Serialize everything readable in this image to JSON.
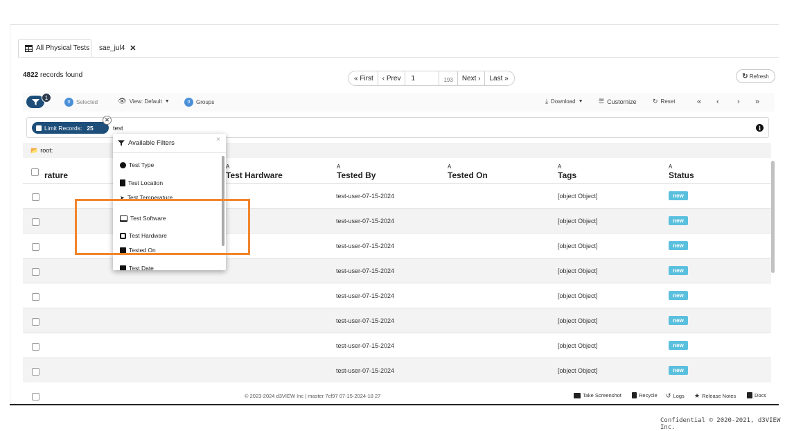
{
  "tabs": [
    {
      "label": "All Physical Tests",
      "active": true
    },
    {
      "label": "sae_jul4",
      "active": false
    }
  ],
  "records": {
    "count": "4822",
    "suffix": "records found"
  },
  "pager": {
    "first": "« First",
    "prev": "‹ Prev",
    "page": "1",
    "total": "193",
    "next": "Next ›",
    "last": "Last »"
  },
  "refresh_label": "Refresh",
  "toolbar": {
    "filter_count": "1",
    "selected_count": "0",
    "selected_label": "Selected",
    "view_label": "View: Default",
    "groups_count": "0",
    "groups_label": "Groups",
    "download_label": "Download",
    "customize_label": "Customize",
    "reset_label": "Reset"
  },
  "search": {
    "limit_label": "Limit Records:",
    "limit_value": "25",
    "query": "test"
  },
  "folder": "root:",
  "table": {
    "sort_marker": "A",
    "columns": [
      {
        "label": "rature",
        "sortable": false
      },
      {
        "label": "Test Hardware",
        "sortable": true
      },
      {
        "label": "Tested By",
        "sortable": true
      },
      {
        "label": "Tested On",
        "sortable": true
      },
      {
        "label": "Tags",
        "sortable": true
      },
      {
        "label": "Status",
        "sortable": true
      }
    ],
    "rows": [
      {
        "tested_by": "test-user-07-15-2024",
        "tags": "[object Object]",
        "status": "new"
      },
      {
        "tested_by": "test-user-07-15-2024",
        "tags": "[object Object]",
        "status": "new"
      },
      {
        "tested_by": "test-user-07-15-2024",
        "tags": "[object Object]",
        "status": "new"
      },
      {
        "tested_by": "test-user-07-15-2024",
        "tags": "[object Object]",
        "status": "new"
      },
      {
        "tested_by": "test-user-07-15-2024",
        "tags": "[object Object]",
        "status": "new"
      },
      {
        "tested_by": "test-user-07-15-2024",
        "tags": "[object Object]",
        "status": "new"
      },
      {
        "tested_by": "test-user-07-15-2024",
        "tags": "[object Object]",
        "status": "new"
      },
      {
        "tested_by": "test-user-07-15-2024",
        "tags": "[object Object]",
        "status": "new"
      }
    ]
  },
  "filters_dropdown": {
    "title": "Available Filters",
    "items": [
      {
        "label": "Test Type",
        "icon": "circle-icon"
      },
      {
        "label": "Test Location",
        "icon": "building-icon"
      },
      {
        "label": "Test Temperature",
        "icon": "thermometer-icon"
      },
      {
        "label": "Test Software",
        "icon": "monitor-icon"
      },
      {
        "label": "Test Hardware",
        "icon": "chip-icon"
      },
      {
        "label": "Tested On",
        "icon": "calendar-icon"
      },
      {
        "label": "Test Date",
        "icon": "calendar-icon"
      }
    ]
  },
  "footer": {
    "copyright": "© 2023-2024 d3VIEW Inc | master 7cf97 07-15-2024-18 27",
    "screenshot_label": "Take Screenshot",
    "recycle_label": "Recycle",
    "logs_label": "Logs",
    "release_notes_label": "Release Notes",
    "docs_label": "Docs"
  },
  "confidential": "Confidential © 2020-2021, d3VIEW Inc.",
  "colors": {
    "brand": "#1e4f7a",
    "status_new": "#5bc0de",
    "highlight": "#f2852c"
  }
}
